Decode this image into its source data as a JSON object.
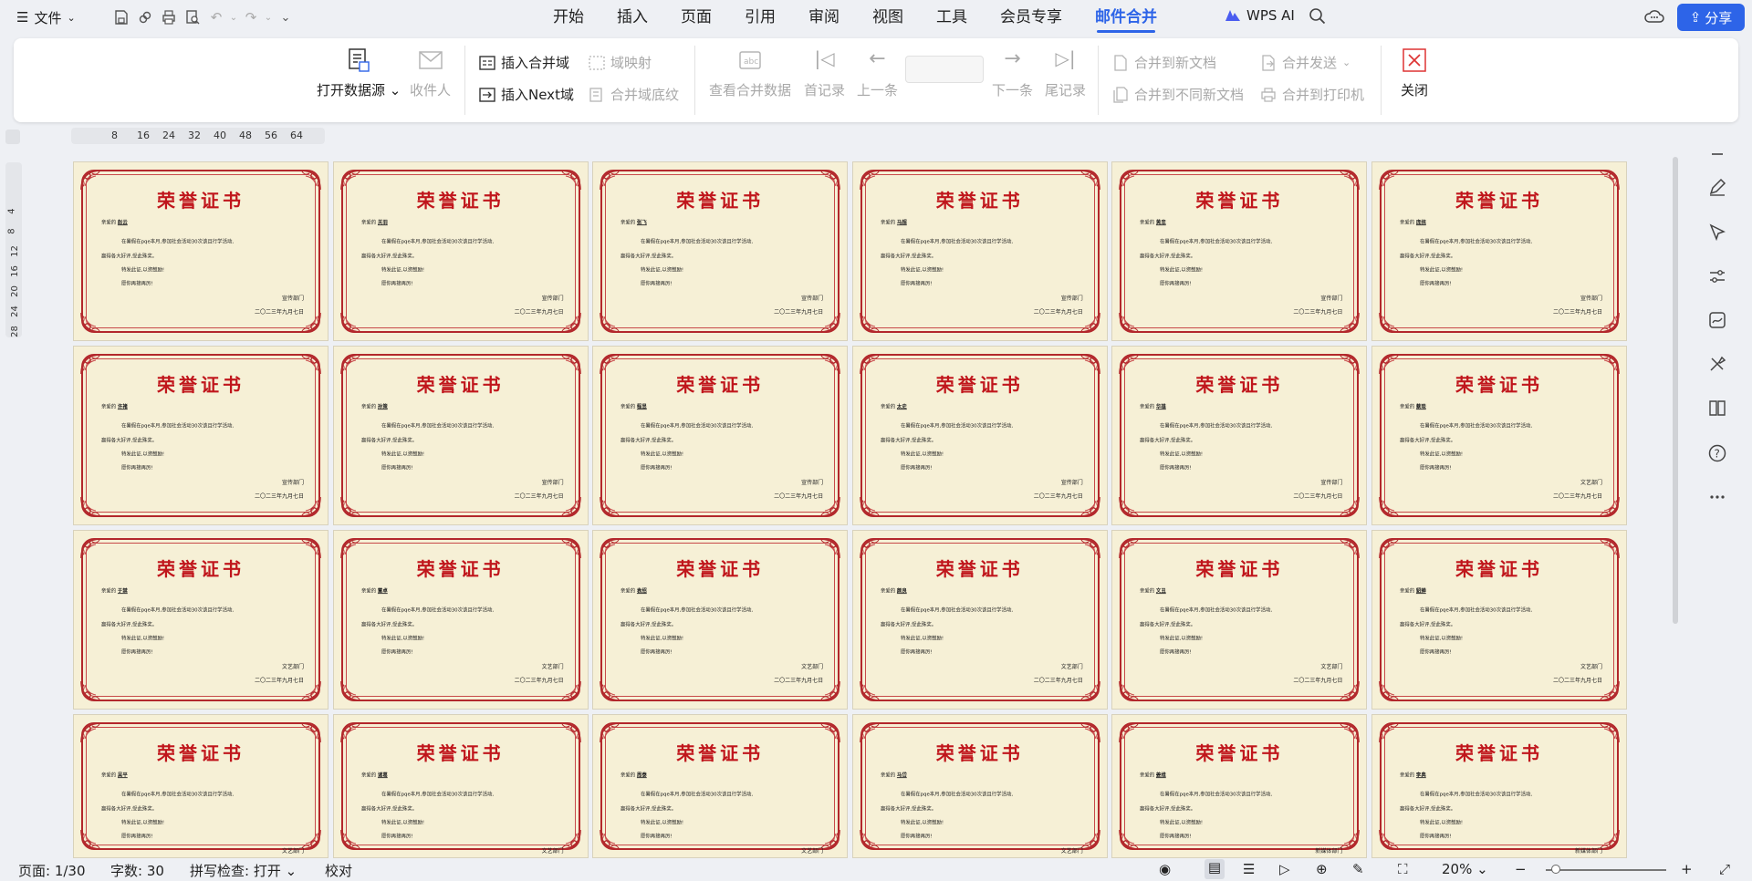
{
  "menubar": {
    "file_label": "文件",
    "tabs": [
      "开始",
      "插入",
      "页面",
      "引用",
      "审阅",
      "视图",
      "工具",
      "会员专享",
      "邮件合并"
    ],
    "active_tab": "邮件合并",
    "wps_ai": "WPS AI",
    "share": "分享",
    "accent_color": "#2d64e8"
  },
  "ribbon": {
    "open_source": "打开数据源",
    "recipients": "收件人",
    "insert_field": "插入合并域",
    "insert_next": "插入Next域",
    "field_map": "域映射",
    "field_shading": "合并域底纹",
    "view_data": "查看合并数据",
    "first": "首记录",
    "prev": "上一条",
    "next": "下一条",
    "last": "尾记录",
    "merge_new_doc": "合并到新文档",
    "merge_diff_doc": "合并到不同新文档",
    "merge_send": "合并发送",
    "merge_printer": "合并到打印机",
    "close": "关闭"
  },
  "ruler": {
    "h_ticks": [
      "8",
      "16",
      "24",
      "32",
      "40",
      "48",
      "56",
      "64"
    ],
    "v_ticks": [
      "4",
      "8",
      "12",
      "16",
      "20",
      "24",
      "28"
    ]
  },
  "certificate": {
    "title": "荣誉证书",
    "body1": "在暑假在pqe本月,参加社会活动30次该且行学活动,",
    "body2": "赢得各大好评,受此殊奖。",
    "body3": "特发此证,以资鼓励!",
    "body4": "愿你再接再厉!",
    "date": "二〇二三年九月七日"
  },
  "certificates": [
    {
      "name": "赵云",
      "dept": "宣传部门"
    },
    {
      "name": "关羽",
      "dept": "宣传部门"
    },
    {
      "name": "张飞",
      "dept": "宣传部门"
    },
    {
      "name": "马超",
      "dept": "宣传部门"
    },
    {
      "name": "黄忠",
      "dept": "宣传部门"
    },
    {
      "name": "庞统",
      "dept": "宣传部门"
    },
    {
      "name": "许褚",
      "dept": "宣传部门"
    },
    {
      "name": "孙策",
      "dept": "宣传部门"
    },
    {
      "name": "程昱",
      "dept": "宣传部门"
    },
    {
      "name": "太史",
      "dept": "宣传部门"
    },
    {
      "name": "华雄",
      "dept": "宣传部门"
    },
    {
      "name": "蔡琰",
      "dept": "文艺部门"
    },
    {
      "name": "于禁",
      "dept": "文艺部门"
    },
    {
      "name": "董卓",
      "dept": "文艺部门"
    },
    {
      "name": "袁绍",
      "dept": "文艺部门"
    },
    {
      "name": "颜良",
      "dept": "文艺部门"
    },
    {
      "name": "文丑",
      "dept": "文艺部门"
    },
    {
      "name": "貂蝉",
      "dept": "文艺部门"
    },
    {
      "name": "吴平",
      "dept": "文艺部门"
    },
    {
      "name": "诸葛",
      "dept": "文艺部门"
    },
    {
      "name": "周泰",
      "dept": "文艺部门"
    },
    {
      "name": "马岱",
      "dept": "文艺部门"
    },
    {
      "name": "姜维",
      "dept": "新媒体部门"
    },
    {
      "name": "李典",
      "dept": "新媒体部门"
    }
  ],
  "status": {
    "page": "页面: 1/30",
    "words": "字数: 30",
    "spell": "拼写检查: 打开",
    "proof": "校对",
    "zoom": "20%"
  }
}
